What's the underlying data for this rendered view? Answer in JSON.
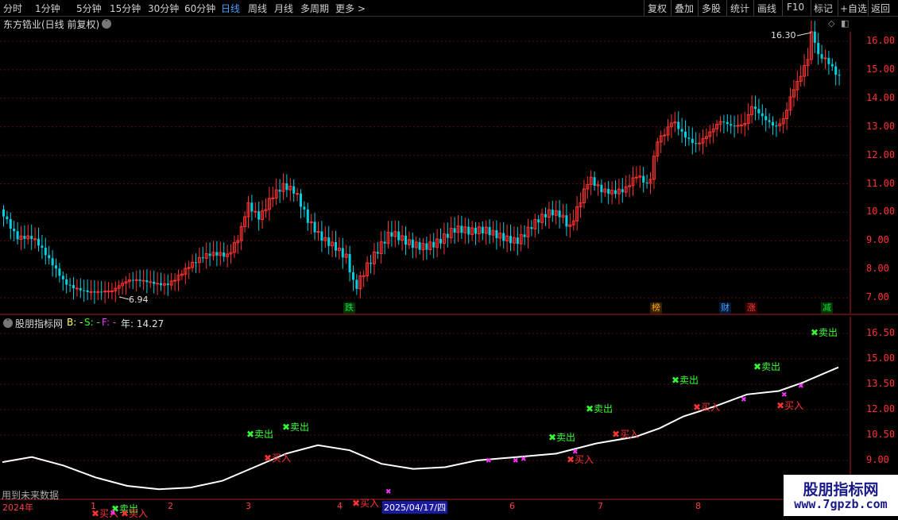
{
  "toolbar": {
    "periods": [
      "分时",
      "1分钟",
      "5分钟",
      "15分钟",
      "30分钟",
      "60分钟",
      "日线",
      "周线",
      "月线",
      "多周期",
      "更多 >"
    ],
    "active_period": "日线",
    "actions": [
      "复权",
      "叠加",
      "多股",
      "统计",
      "画线",
      "F10",
      "标记",
      "+自选",
      "返回"
    ]
  },
  "main_chart": {
    "title": "东方锆业(日线 前复权)",
    "y_ticks": [
      "16.00",
      "15.00",
      "14.00",
      "13.00",
      "12.00",
      "11.00",
      "10.00",
      "9.00",
      "8.00",
      "7.00"
    ],
    "high_annotation": "16.30",
    "low_annotation": "6.94",
    "events": [
      {
        "label": "跌",
        "color": "#00c040"
      },
      {
        "label": "榜",
        "color": "#ff9900"
      },
      {
        "label": "财",
        "color": "#4a9eff"
      },
      {
        "label": "涨",
        "color": "#ff4040"
      },
      {
        "label": "减",
        "color": "#00c040"
      }
    ]
  },
  "indicator": {
    "title": "股朋指标网",
    "b_label": "B: -",
    "s_label": "S: -",
    "f_label": "F: -",
    "year_label": "年: 14.27",
    "y_ticks": [
      "16.50",
      "15.00",
      "13.50",
      "12.00",
      "10.50",
      "9.00"
    ],
    "future_note": "用到未来数据",
    "sell_label": "卖出",
    "buy_label": "买入"
  },
  "x_axis": {
    "year": "2024年",
    "months": [
      "1",
      "2",
      "3",
      "4",
      "6",
      "7",
      "8"
    ],
    "cursor_date": "2025/04/17/四"
  },
  "watermark": {
    "line1": "股朋指标网",
    "line2": "www.7gpzb.com"
  },
  "colors": {
    "up": "#ff3333",
    "down": "#00d0e0",
    "sell": "#33ff33",
    "buy": "#ff3333",
    "mark": "#ff33ff",
    "curve": "#ffffff"
  }
}
